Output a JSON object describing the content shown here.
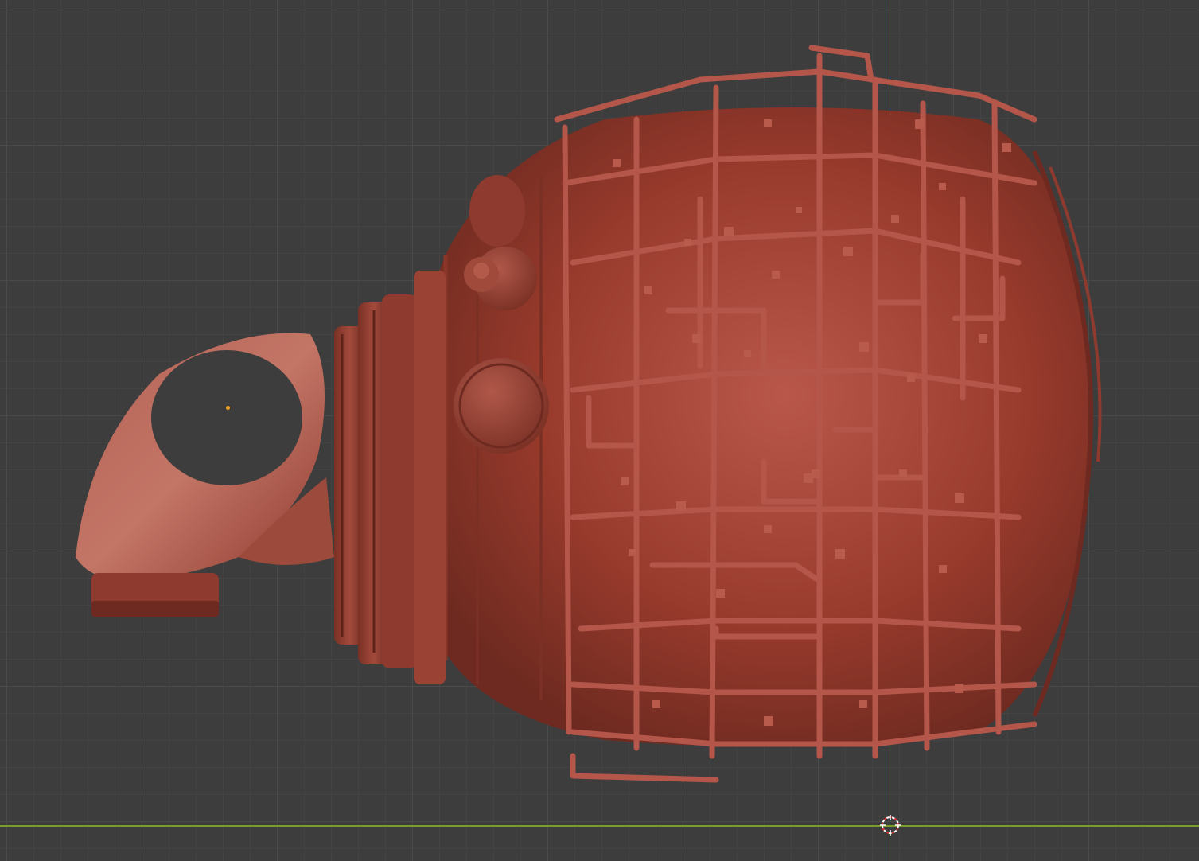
{
  "viewport": {
    "background_color": "#3d3d3d",
    "grid_major_color": "#4a4a4a",
    "grid_minor_color": "#434343",
    "axis_x_color": "#7a9b2e",
    "axis_y_color": "#4e6aa1",
    "mode": "solid-shading"
  },
  "scene": {
    "object_color": "#a8483a",
    "cursor_icon": "3d-cursor-icon",
    "origin_icon": "object-origin-icon"
  }
}
